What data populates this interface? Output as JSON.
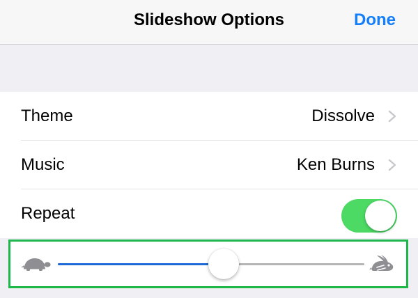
{
  "navbar": {
    "title": "Slideshow Options",
    "done_label": "Done"
  },
  "settings": {
    "theme": {
      "label": "Theme",
      "value": "Dissolve"
    },
    "music": {
      "label": "Music",
      "value": "Ken Burns"
    },
    "repeat": {
      "label": "Repeat",
      "on": true
    }
  },
  "speed_slider": {
    "value": 0.54,
    "min_icon": "turtle-icon",
    "max_icon": "rabbit-icon"
  },
  "colors": {
    "accent": "#147efb",
    "toggle_on": "#4cd964",
    "slider_fill": "#1f6ad6",
    "highlight_border": "#1cb84a"
  }
}
